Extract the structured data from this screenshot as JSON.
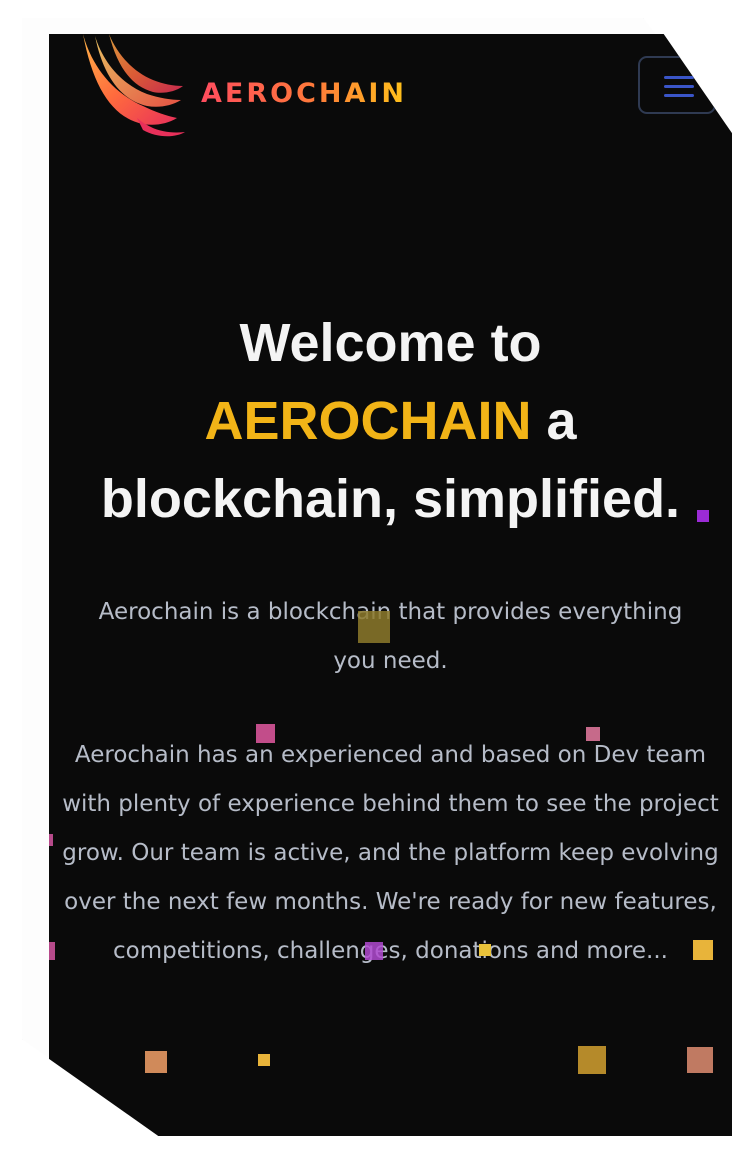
{
  "header": {
    "brand_name": "AEROCHAIN",
    "logo_icon": "wing-logo-icon",
    "menu_icon": "hamburger-menu-icon"
  },
  "hero": {
    "line1": "Welcome to",
    "accent_word": "AEROCHAIN",
    "line2_rest": " a",
    "line3": "blockchain, simplified."
  },
  "content": {
    "lead": "Aerochain is a blockchain that provides everything you need.",
    "body": "Aerochain has an experienced and based on Dev team with plenty of experience behind them to see the project grow. Our team is active, and the platform keep evolving over the next few months. We're ready for new features, competitions, challenges, donations and more..."
  },
  "colors": {
    "background": "#0a0a0a",
    "accent": "#f2b417",
    "heading": "#f4f4f4",
    "body": "#b6bcc8",
    "brand_gradient": [
      "#ff4c5e",
      "#ff7a3a",
      "#ffc21a"
    ]
  }
}
